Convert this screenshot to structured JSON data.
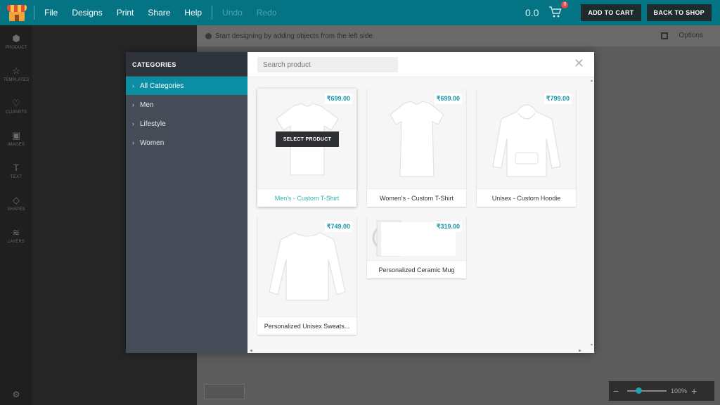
{
  "topbar": {
    "menu": [
      "File",
      "Designs",
      "Print",
      "Share",
      "Help"
    ],
    "undo": "Undo",
    "redo": "Redo",
    "total": "0.0",
    "cart_count": "0",
    "add_to_cart": "ADD TO CART",
    "back_to_shop": "BACK TO SHOP"
  },
  "rail": {
    "items": [
      {
        "label": "PRODUCT",
        "icon": "box-icon"
      },
      {
        "label": "TEMPLATES",
        "icon": "star-icon"
      },
      {
        "label": "CLIPARTS",
        "icon": "heart-icon"
      },
      {
        "label": "IMAGES",
        "icon": "image-icon"
      },
      {
        "label": "TEXT",
        "icon": "text-icon"
      },
      {
        "label": "SHAPES",
        "icon": "diamond-icon"
      },
      {
        "label": "LAYERS",
        "icon": "layers-icon"
      }
    ]
  },
  "workspace": {
    "hint": "Start designing by adding objects from the left side",
    "options": "Options",
    "zoom": "100%"
  },
  "modal": {
    "categories_title": "CATEGORIES",
    "categories": [
      "All Categories",
      "Men",
      "Lifestyle",
      "Women"
    ],
    "active_category": "All Categories",
    "search_placeholder": "Search product",
    "select_product": "SELECT PRODUCT",
    "products": [
      {
        "name": "Men's - Custom T-Shirt",
        "price": "₹699.00"
      },
      {
        "name": "Women's - Custom T-Shirt",
        "price": "₹699.00"
      },
      {
        "name": "Unisex - Custom Hoodie",
        "price": "₹799.00"
      },
      {
        "name": "Personalized Unisex Sweats...",
        "price": "₹749.00"
      },
      {
        "name": "Personalized Ceramic Mug",
        "price": "₹319.00"
      }
    ]
  },
  "colors": {
    "topbar": "#047484",
    "accent": "#0b8ea3",
    "price": "#1493a9"
  }
}
